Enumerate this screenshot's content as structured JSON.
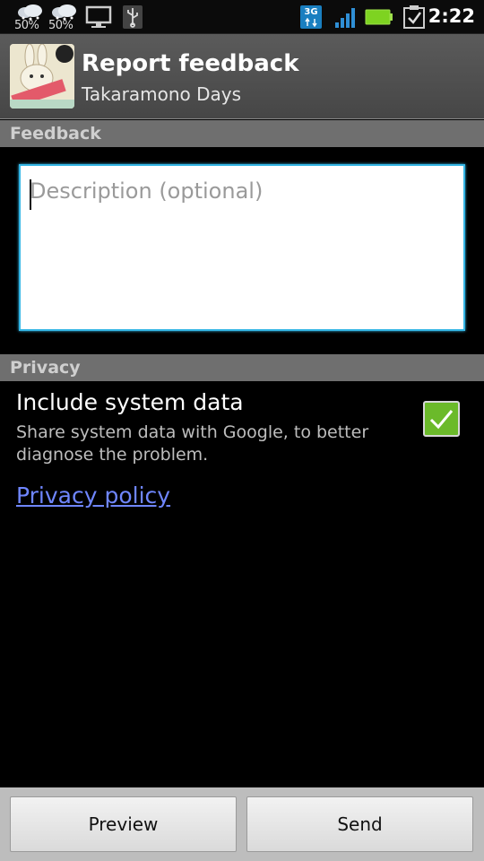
{
  "status_bar": {
    "weather": [
      {
        "icon": "cloud-snow-icon",
        "value": "50%"
      },
      {
        "icon": "cloud-snow-icon",
        "value": "50%"
      }
    ],
    "network": "3G",
    "time": "2:22"
  },
  "header": {
    "title": "Report feedback",
    "subtitle": "Takaramono Days"
  },
  "sections": {
    "feedback": "Feedback",
    "privacy": "Privacy"
  },
  "description": {
    "placeholder": "Description (optional)",
    "value": ""
  },
  "system_data": {
    "title": "Include system data",
    "summary": "Share system data with Google, to better diagnose the problem.",
    "checked": true
  },
  "privacy_link": "Privacy policy",
  "buttons": {
    "preview": "Preview",
    "send": "Send"
  },
  "colors": {
    "accent_blue": "#35b6e5",
    "checkbox_green": "#6bba2a",
    "link": "#6f86ff"
  }
}
